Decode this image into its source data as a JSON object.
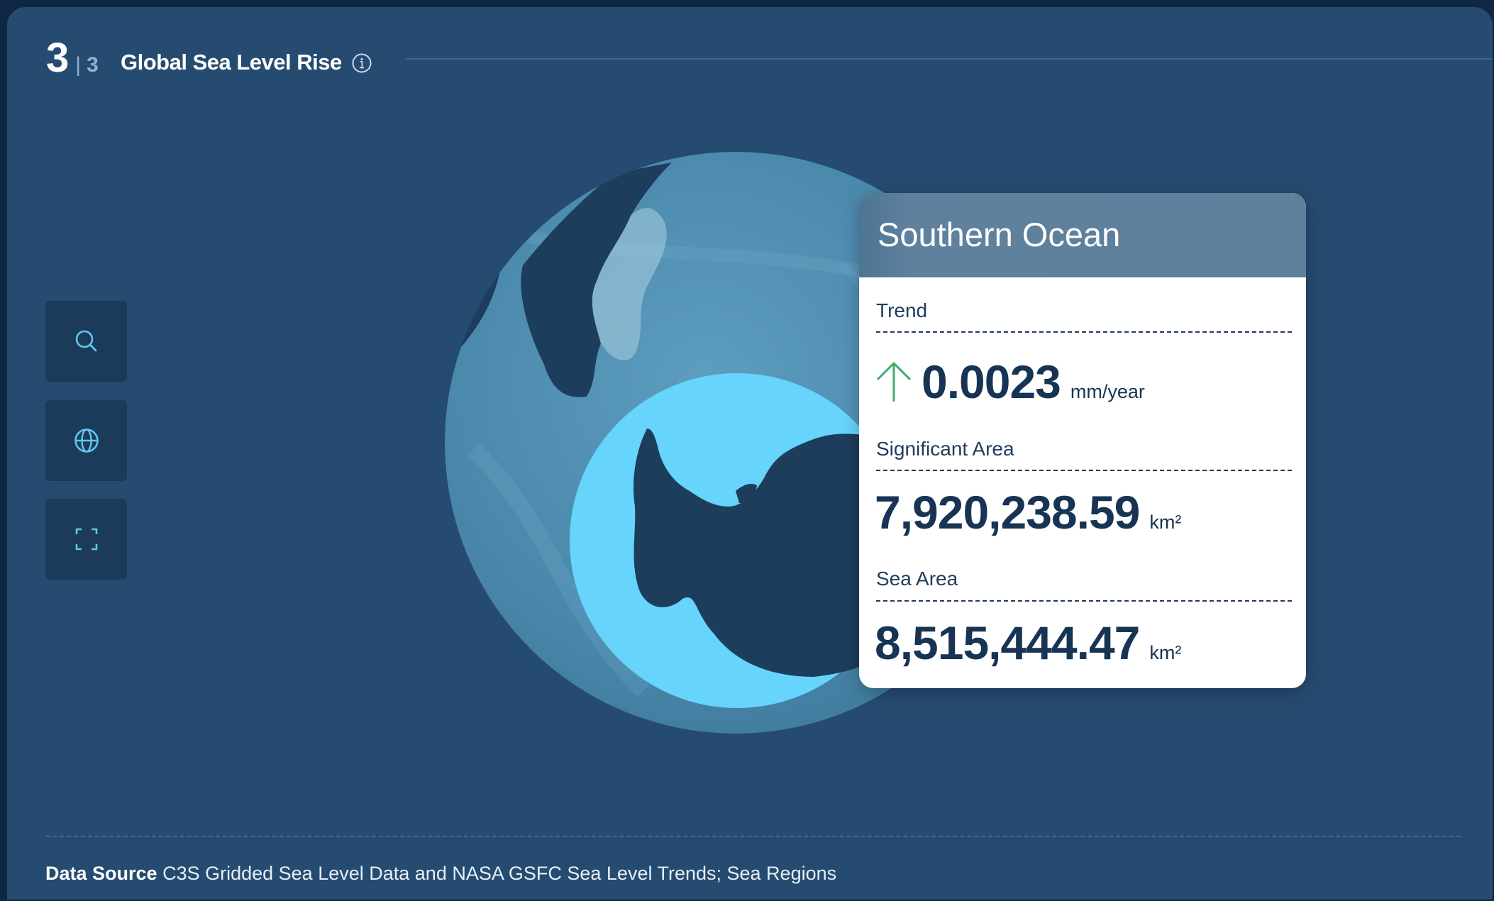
{
  "header": {
    "step_current": "3",
    "step_separator": "|",
    "step_total": "3",
    "title": "Global Sea Level Rise",
    "info_icon": "info-icon"
  },
  "tools": [
    {
      "name": "search",
      "icon": "search-icon"
    },
    {
      "name": "globe",
      "icon": "globe-icon"
    },
    {
      "name": "fullscreen",
      "icon": "fullscreen-icon"
    }
  ],
  "card": {
    "region": "Southern Ocean",
    "trend": {
      "label": "Trend",
      "value": "0.0023",
      "unit": "mm/year",
      "direction": "up",
      "arrow_color": "#3fae6b"
    },
    "significant_area": {
      "label": "Significant Area",
      "value": "7,920,238.59",
      "unit": "km²"
    },
    "sea_area": {
      "label": "Sea Area",
      "value": "8,515,444.47",
      "unit": "km²"
    }
  },
  "footer": {
    "label": "Data Source",
    "text": "C3S Gridded Sea Level Data and NASA GSFC Sea Level Trends; Sea Regions"
  },
  "colors": {
    "background": "#264b70",
    "ocean": "#4f8fb2",
    "highlight": "#66d4fb",
    "land": "#1c3d5c",
    "accent": "#5fc8f0"
  }
}
